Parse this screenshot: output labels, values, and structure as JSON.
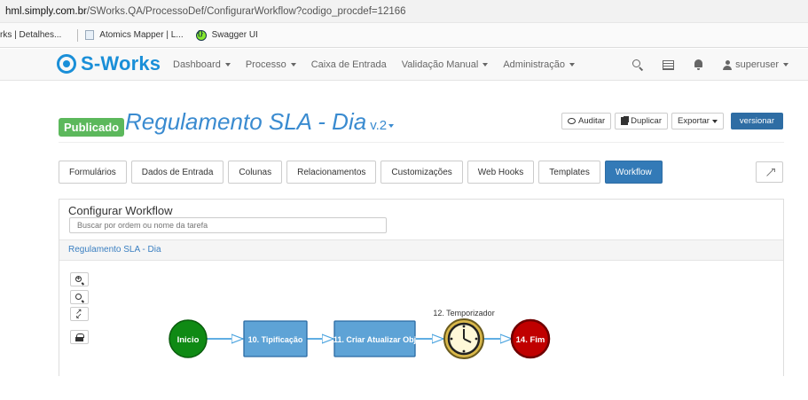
{
  "browser": {
    "url_host": "hml.simply.com.br",
    "url_path": "/SWorks.QA/ProcessoDef/ConfigurarWorkflow?codigo_procdef=12166",
    "bookmarks": [
      {
        "label": "rks | Detalhes..."
      },
      {
        "label": "Atomics Mapper | L..."
      },
      {
        "label": "Swagger UI"
      }
    ]
  },
  "navbar": {
    "brand": "S-Works",
    "items": [
      {
        "label": "Dashboard",
        "dropdown": true
      },
      {
        "label": "Processo",
        "dropdown": true
      },
      {
        "label": "Caixa de Entrada",
        "dropdown": false
      },
      {
        "label": "Validação Manual",
        "dropdown": true
      },
      {
        "label": "Administração",
        "dropdown": true
      }
    ],
    "user": "superuser"
  },
  "header": {
    "status_badge": "Publicado",
    "title": "Regulamento SLA - Dia",
    "version": "v.2",
    "actions": {
      "audit": "Auditar",
      "duplicate": "Duplicar",
      "export": "Exportar",
      "version": "versionar"
    }
  },
  "tabs": [
    {
      "label": "Formulários",
      "active": false
    },
    {
      "label": "Dados de Entrada",
      "active": false
    },
    {
      "label": "Colunas",
      "active": false
    },
    {
      "label": "Relacionamentos",
      "active": false
    },
    {
      "label": "Customizações",
      "active": false
    },
    {
      "label": "Web Hooks",
      "active": false
    },
    {
      "label": "Templates",
      "active": false
    },
    {
      "label": "Workflow",
      "active": true
    }
  ],
  "workflow": {
    "panel_title": "Configurar Workflow",
    "search_placeholder": "Buscar por ordem ou nome da tarefa",
    "process_name": "Regulamento SLA - Dia",
    "nodes": {
      "start": "Inicio",
      "task1": "10. Tipificação",
      "task2": "11. Criar Atualizar Obj",
      "timer_label": "12. Temporizador",
      "end": "14. Fim"
    }
  },
  "colors": {
    "brand": "#1a8fd8",
    "badge": "#5cb85c",
    "primary": "#337ab7",
    "start_node": "#0f8a14",
    "task_fill": "#5ea3d6",
    "end_node": "#c00000",
    "timer_fill": "#d9b84a"
  }
}
